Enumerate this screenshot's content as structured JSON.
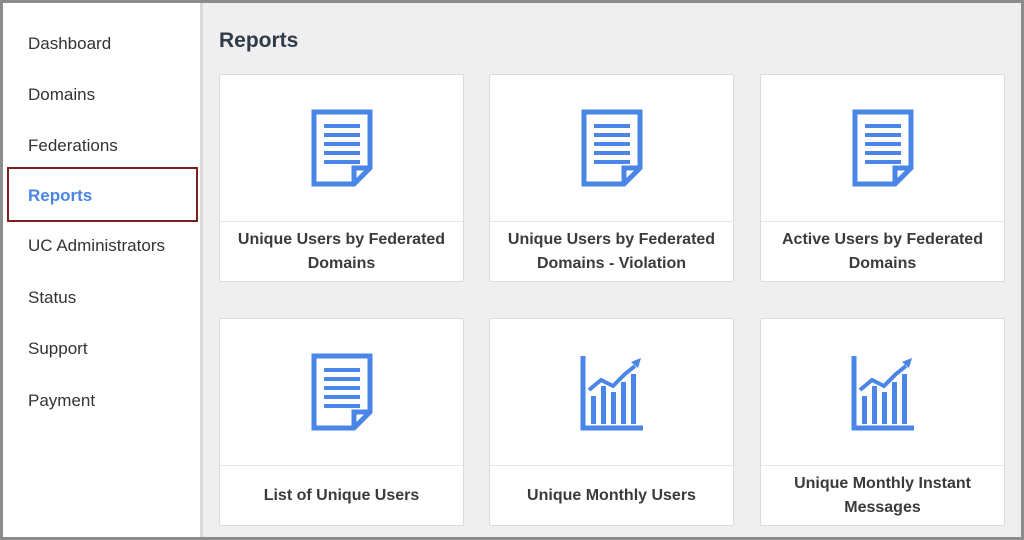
{
  "sidebar": {
    "items": [
      {
        "label": "Dashboard"
      },
      {
        "label": "Domains"
      },
      {
        "label": "Federations"
      },
      {
        "label": "Reports"
      },
      {
        "label": "UC Administrators"
      },
      {
        "label": "Status"
      },
      {
        "label": "Support"
      },
      {
        "label": "Payment"
      }
    ],
    "active_item": "Reports"
  },
  "main": {
    "title": "Reports",
    "cards": [
      {
        "label": "Unique Users by Federated Domains",
        "icon": "document-icon"
      },
      {
        "label": "Unique Users by Federated Domains - Violation",
        "icon": "document-icon"
      },
      {
        "label": "Active Users by Federated Domains",
        "icon": "document-icon"
      },
      {
        "label": "List of Unique Users",
        "icon": "document-icon"
      },
      {
        "label": "Unique Monthly Users",
        "icon": "bar-chart-trend-icon"
      },
      {
        "label": "Unique Monthly Instant Messages",
        "icon": "bar-chart-trend-icon"
      }
    ]
  },
  "colors": {
    "accent": "#4a86e8",
    "active_highlight_border": "#7b1f1f",
    "main_background": "#efefef"
  }
}
